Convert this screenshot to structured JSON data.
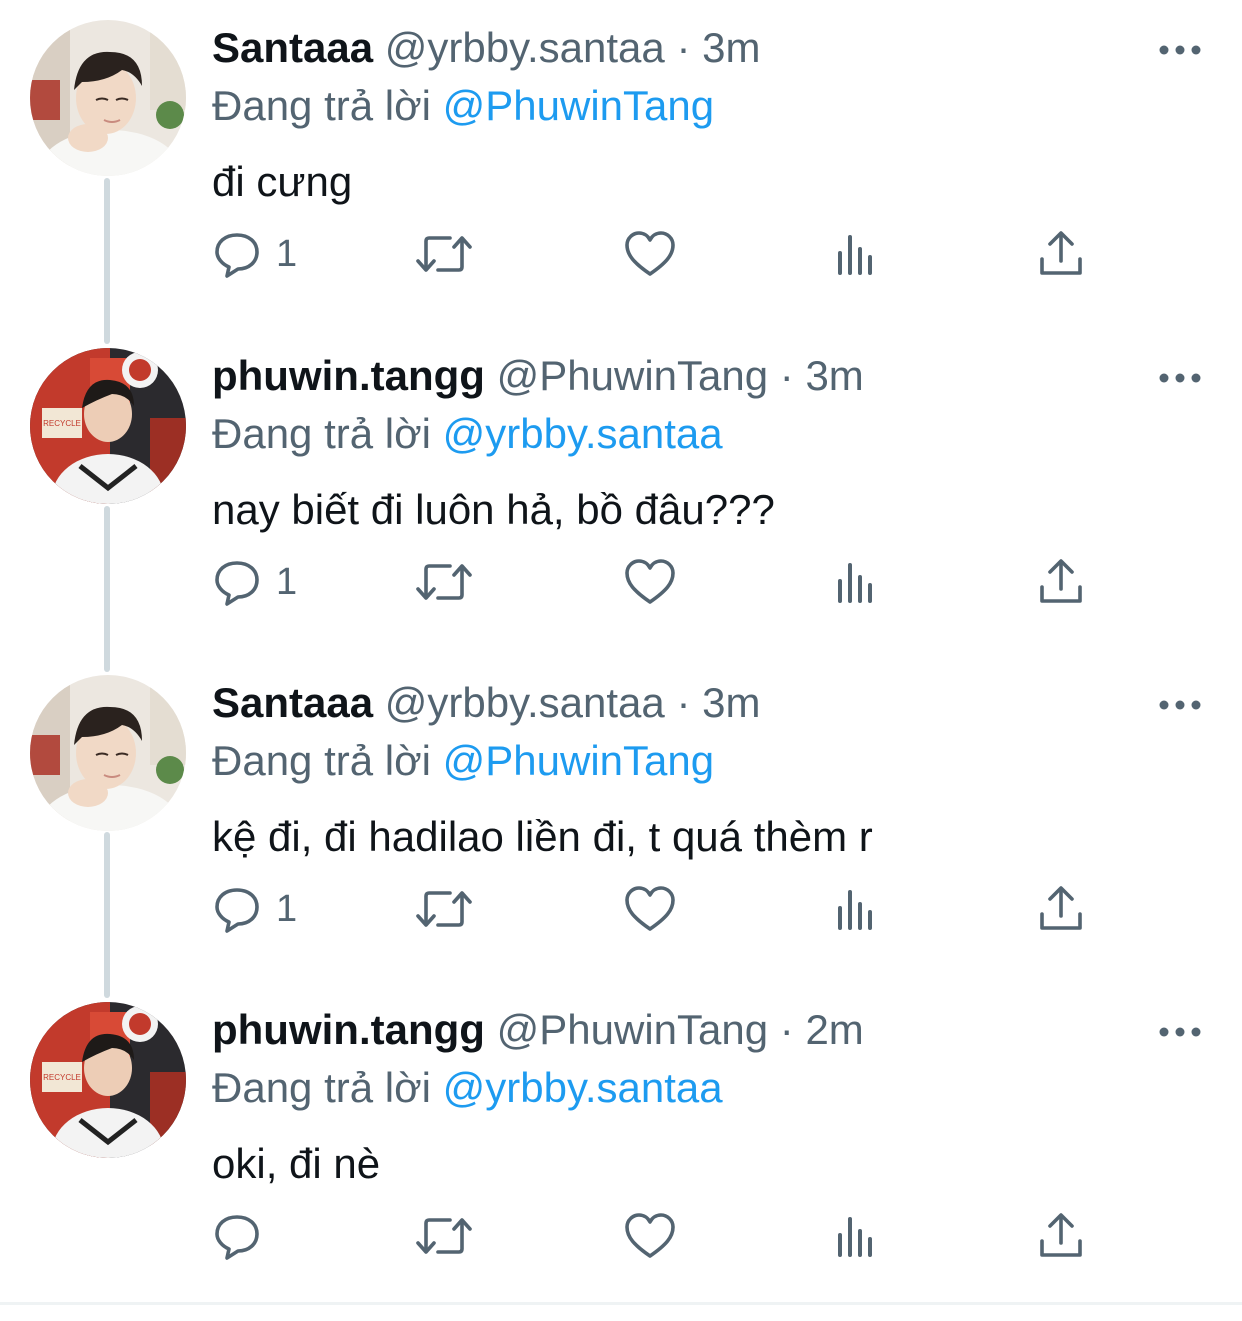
{
  "colors": {
    "text_primary": "#0f1419",
    "text_secondary": "#536471",
    "link": "#1d9bf0",
    "thread_line": "#cfd9de"
  },
  "tweets": [
    {
      "display_name": "Santaaa",
      "handle": "@yrbby.santaa",
      "separator": "·",
      "time": "3m",
      "reply_prefix": "Đang trả lời",
      "reply_to": "@PhuwinTang",
      "text": "đi cưng",
      "reply_count": "1",
      "avatar_icon": "avatar-santaaa"
    },
    {
      "display_name": "phuwin.tangg",
      "handle": "@PhuwinTang",
      "separator": "·",
      "time": "3m",
      "reply_prefix": "Đang trả lời",
      "reply_to": "@yrbby.santaa",
      "text": "nay biết đi luôn hả, bồ đâu???",
      "reply_count": "1",
      "avatar_icon": "avatar-phuwin"
    },
    {
      "display_name": "Santaaa",
      "handle": "@yrbby.santaa",
      "separator": "·",
      "time": "3m",
      "reply_prefix": "Đang trả lời",
      "reply_to": "@PhuwinTang",
      "text": "kệ đi, đi hadilao liền đi, t quá thèm r",
      "reply_count": "1",
      "avatar_icon": "avatar-santaaa"
    },
    {
      "display_name": "phuwin.tangg",
      "handle": "@PhuwinTang",
      "separator": "·",
      "time": "2m",
      "reply_prefix": "Đang trả lời",
      "reply_to": "@yrbby.santaa",
      "text": "oki, đi nè",
      "reply_count": "",
      "avatar_icon": "avatar-phuwin"
    }
  ],
  "icons": {
    "reply": "reply-icon",
    "retweet": "retweet-icon",
    "like": "heart-icon",
    "views": "views-icon",
    "share": "share-icon",
    "more": "more-icon"
  },
  "avatar_sign_text": "RECYCLE"
}
